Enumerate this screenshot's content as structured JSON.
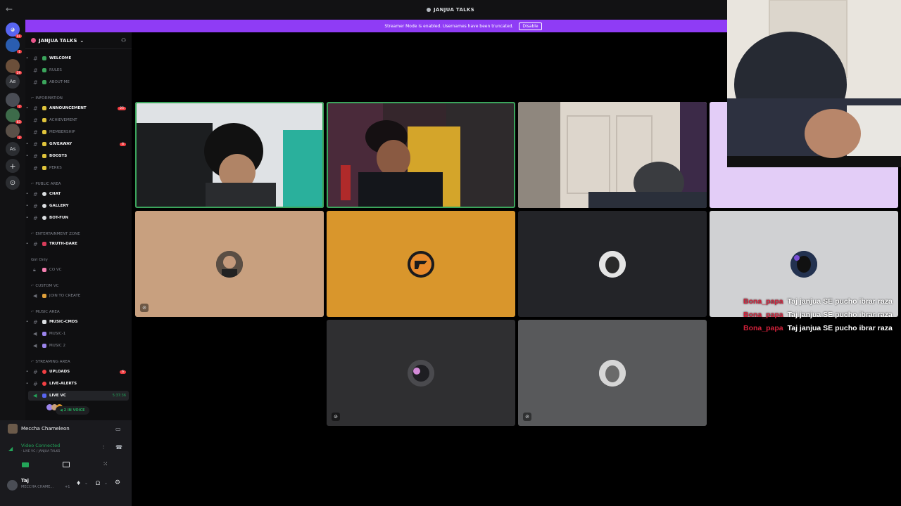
{
  "window": {
    "back_icon": "←",
    "title": "JANJUA TALKS"
  },
  "streamer_banner": {
    "text": "Streamer Mode is enabled. Usernames have been truncated.",
    "button": "Disable"
  },
  "server": {
    "name": "JANJUA TALKS",
    "chevron": "⌄",
    "invite_icon": "person-add-icon"
  },
  "guilds": [
    {
      "label": "",
      "badge": "41"
    },
    {
      "label": "",
      "badge": "1"
    },
    {
      "label": "",
      "badge": "29"
    },
    {
      "label": "Ae",
      "badge": ""
    },
    {
      "label": "",
      "badge": "7"
    },
    {
      "label": "",
      "badge": "83"
    },
    {
      "label": "",
      "badge": "2"
    },
    {
      "label": "As",
      "badge": ""
    },
    {
      "label": "+",
      "badge": ""
    },
    {
      "label": "⊙",
      "badge": ""
    }
  ],
  "channels": {
    "welcome": "WELCOME",
    "rules": "RULES",
    "about": "ABOUT-ME",
    "cat_information": "⌐ INFORMATION",
    "announcement": "ANNOUNCEMENT",
    "announcement_count": "25",
    "achievement": "ACHIEVEMENT",
    "membership": "MEMBERSHIP",
    "giveaway": "GIVEAWAY",
    "giveaway_count": "6",
    "boosts": "BOOSTS",
    "perks": "PERKS",
    "cat_public": "⌐ PUBLIC AREA",
    "chat": "CHAT",
    "gallery": "GALLERY",
    "botfun": "BOT-FUN",
    "cat_entertainment": "⌐ ENTERTAINMENT ZONE",
    "truthdare": "TRUTH-DARE",
    "cat_girl": "Girl Only",
    "covc": "CO VC",
    "cat_custom": "⌐ CUSTOM VC",
    "jointocreate": "JOIN TO CREATE",
    "cat_music": "⌐ MUSIC AREA",
    "musiccmds": "MUSIC-CMDS",
    "music1": "MUSIC-1",
    "music2": "MUSIC 2",
    "cat_streaming": "⌐ STREAMING AREA",
    "uploads": "UPLOADS",
    "uploads_count": "6",
    "livealerts": "LIVE-ALERTS",
    "livevc": "LIVE VC",
    "livevc_time": "5:37:36",
    "in_voice": "2 IN VOICE"
  },
  "user_panel": {
    "activity_name": "Meccha Chameleon",
    "video_status": "Video Connected",
    "video_sub": "· LIVE VC / JANJUA TALKS",
    "username": "Taj",
    "user_status": "MECCHA CHAME...",
    "user_status_extra": "+1"
  },
  "chat_overlay": [
    {
      "user": "Bona_papa",
      "text": "Taj janjua SE pucho ibrar raza"
    },
    {
      "user": "Bona_papa",
      "text": "Taj janjua SE pucho ibrar raza"
    },
    {
      "user": "Bona_papa",
      "text": "Taj janjua SE pucho ibrar raza"
    }
  ],
  "colors": {
    "accent": "#8f3cf5",
    "speaking": "#3ba55c",
    "tan_tile": "#c8a07f",
    "orange_tile": "#d9962c",
    "lavender_tile": "#e3cdf7"
  }
}
